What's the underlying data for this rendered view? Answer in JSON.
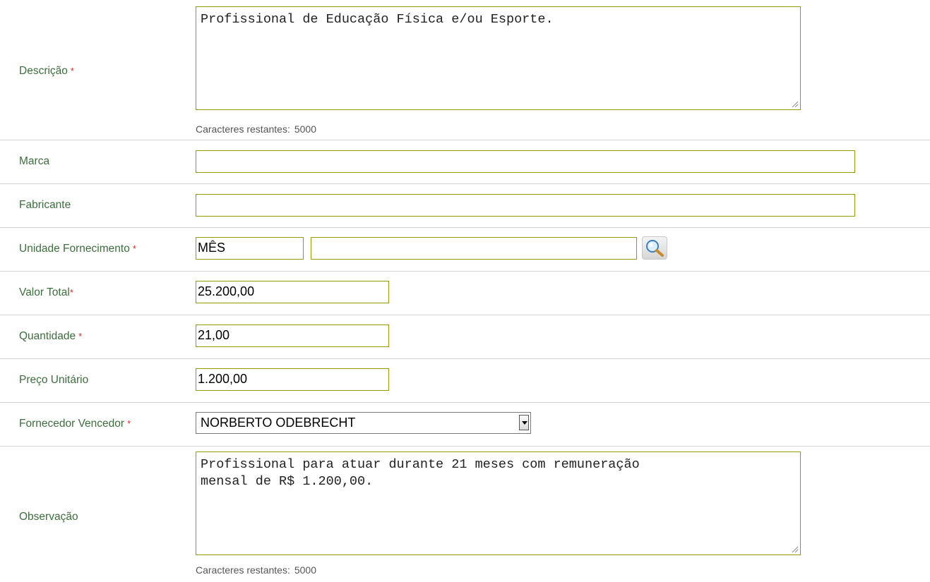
{
  "required_mark": "*",
  "descricao": {
    "label": "Descrição",
    "value": "Profissional de Educação Física e/ou Esporte.",
    "remaining_label": "Caracteres restantes:",
    "remaining_value": "5000"
  },
  "marca": {
    "label": "Marca",
    "value": ""
  },
  "fabricante": {
    "label": "Fabricante",
    "value": ""
  },
  "unidade": {
    "label": "Unidade Fornecimento",
    "code_value": "MÊS",
    "desc_value": "",
    "lookup_icon": "search-icon"
  },
  "valor_total": {
    "label": "Valor Total",
    "value": "25.200,00"
  },
  "quantidade": {
    "label": "Quantidade",
    "value": "21,00"
  },
  "preco_unitario": {
    "label": "Preço Unitário",
    "value": "1.200,00"
  },
  "fornecedor": {
    "label": "Fornecedor Vencedor",
    "selected": "NORBERTO ODEBRECHT"
  },
  "observacao": {
    "label": "Observação",
    "value": "Profissional para atuar durante 21 meses com remuneração\nmensal de R$ 1.200,00.",
    "remaining_label": "Caracteres restantes:",
    "remaining_value": "5000"
  },
  "colors": {
    "label": "#3c6e3c",
    "required": "#e8292b",
    "field_border": "#999900",
    "divider": "#d4d4d4"
  }
}
